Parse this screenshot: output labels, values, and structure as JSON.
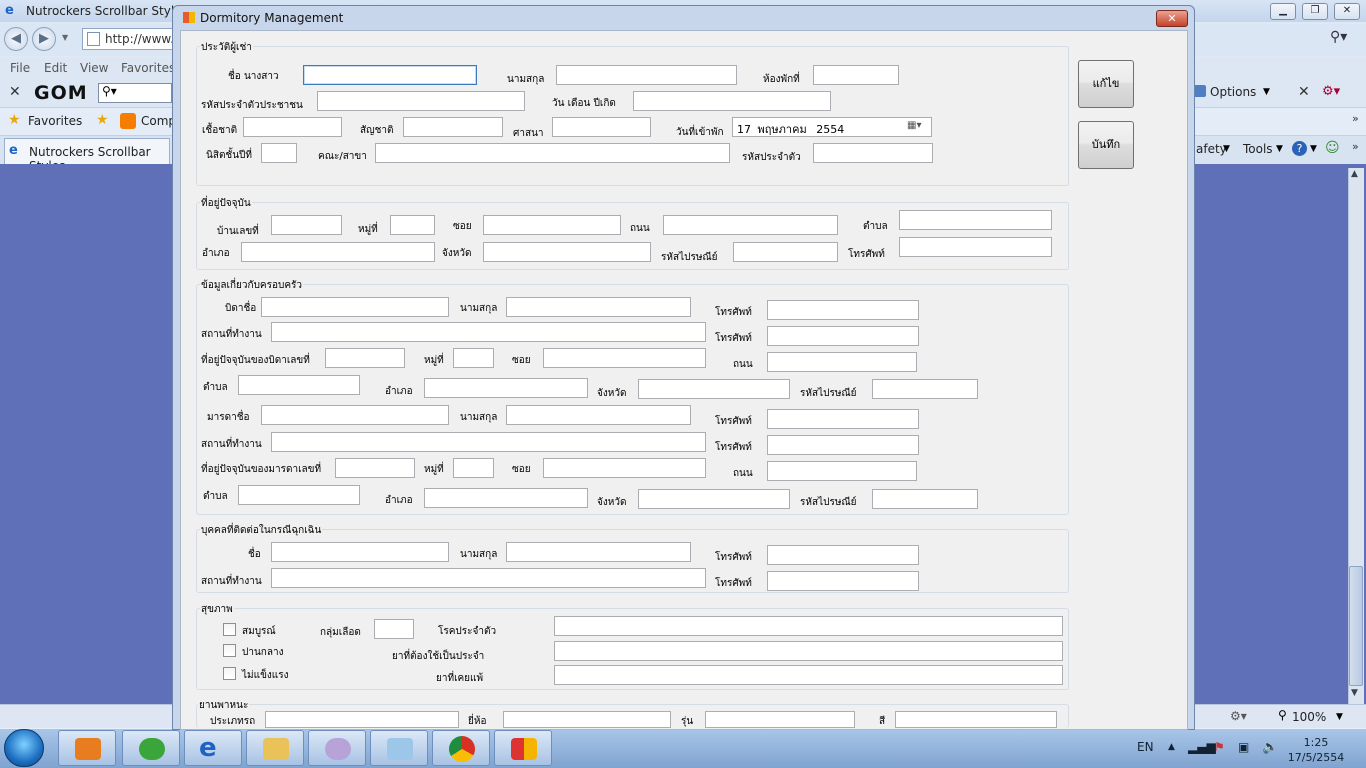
{
  "browser": {
    "title": "Nutrockers Scrollbar StylesH",
    "url": "http://www.",
    "menu": [
      "File",
      "Edit",
      "View",
      "Favorites"
    ],
    "gom": "GOM",
    "options_label": "Options",
    "favorites_label": "Favorites",
    "fav_item": "Comp",
    "tab_title": "Nutrockers Scrollbar Styles",
    "safety_label": "afety",
    "tools_label": "Tools",
    "zoom": "100%"
  },
  "taskbar": {
    "lang": "EN",
    "time": "1:25",
    "date": "17/5/2554"
  },
  "dialog": {
    "title": "Dormitory Management",
    "close": "✕",
    "buttons": {
      "edit": "แก้ไข",
      "save": "บันทึก"
    },
    "tenant": {
      "group": "ประวัติผู้เช่า",
      "firstname_label": "ชื่อ นางสาว",
      "lastname_label": "นามสกุล",
      "room_label": "ห้องพักที่",
      "citizen_id_label": "รหัสประจำตัวประชาชน",
      "birthdate_label": "วัน เดือน ปีเกิด",
      "ethnicity_label": "เชื้อชาติ",
      "nationality_label": "สัญชาติ",
      "religion_label": "ศาสนา",
      "checkin_label": "วันที่เข้าพัก",
      "checkin_day": "17",
      "checkin_month": "พฤษภาคม",
      "checkin_year": "2554",
      "year_label": "นิสิตชั้นปีที่",
      "faculty_label": "คณะ/สาขา",
      "student_id_label": "รหัสประจำตัว"
    },
    "address": {
      "group": "ที่อยู่ปัจจุบัน",
      "house_no_label": "บ้านเลขที่",
      "moo_label": "หมู่ที่",
      "soi_label": "ซอย",
      "road_label": "ถนน",
      "tambon_label": "ตำบล",
      "amphoe_label": "อำเภอ",
      "province_label": "จังหวัด",
      "postcode_label": "รหัสไปรษณีย์",
      "phone_label": "โทรศัพท์"
    },
    "family": {
      "group": "ข้อมูลเกี่ยวกับครอบครัว",
      "father_name_label": "บิดาชื่อ",
      "lastname_label": "นามสกุล",
      "phone_label": "โทรศัพท์",
      "workplace_label": "สถานที่ทำงาน",
      "father_address_label": "ที่อยู่ปัจจุบันของบิดาเลขที่",
      "moo_label": "หมู่ที่",
      "soi_label": "ซอย",
      "road_label": "ถนน",
      "tambon_label": "ตำบล",
      "amphoe_label": "อำเภอ",
      "province_label": "จังหวัด",
      "postcode_label": "รหัสไปรษณีย์",
      "mother_name_label": "มารดาชื่อ",
      "mother_address_label": "ที่อยู่ปัจจุบันของมารดาเลขที่"
    },
    "emergency": {
      "group": "บุคคลที่ติดต่อในกรณีฉุกเฉิน",
      "name_label": "ชื่อ",
      "lastname_label": "นามสกุล",
      "phone_label": "โทรศัพท์",
      "workplace_label": "สถานที่ทำงาน"
    },
    "health": {
      "group": "สุขภาพ",
      "perfect": "สมบูรณ์",
      "moderate": "ปานกลาง",
      "weak": "ไม่แข็งแรง",
      "blood_label": "กลุ่มเลือด",
      "disease_label": "โรคประจำตัว",
      "medicine_label": "ยาที่ต้องใช้เป็นประจำ",
      "allergy_label": "ยาที่เคยแพ้"
    },
    "vehicle": {
      "group": "ยานพาหนะ",
      "type_label": "ประเภทรถ",
      "brand_label": "ยี่ห้อ",
      "model_label": "รุ่น",
      "color_label": "สี"
    }
  }
}
